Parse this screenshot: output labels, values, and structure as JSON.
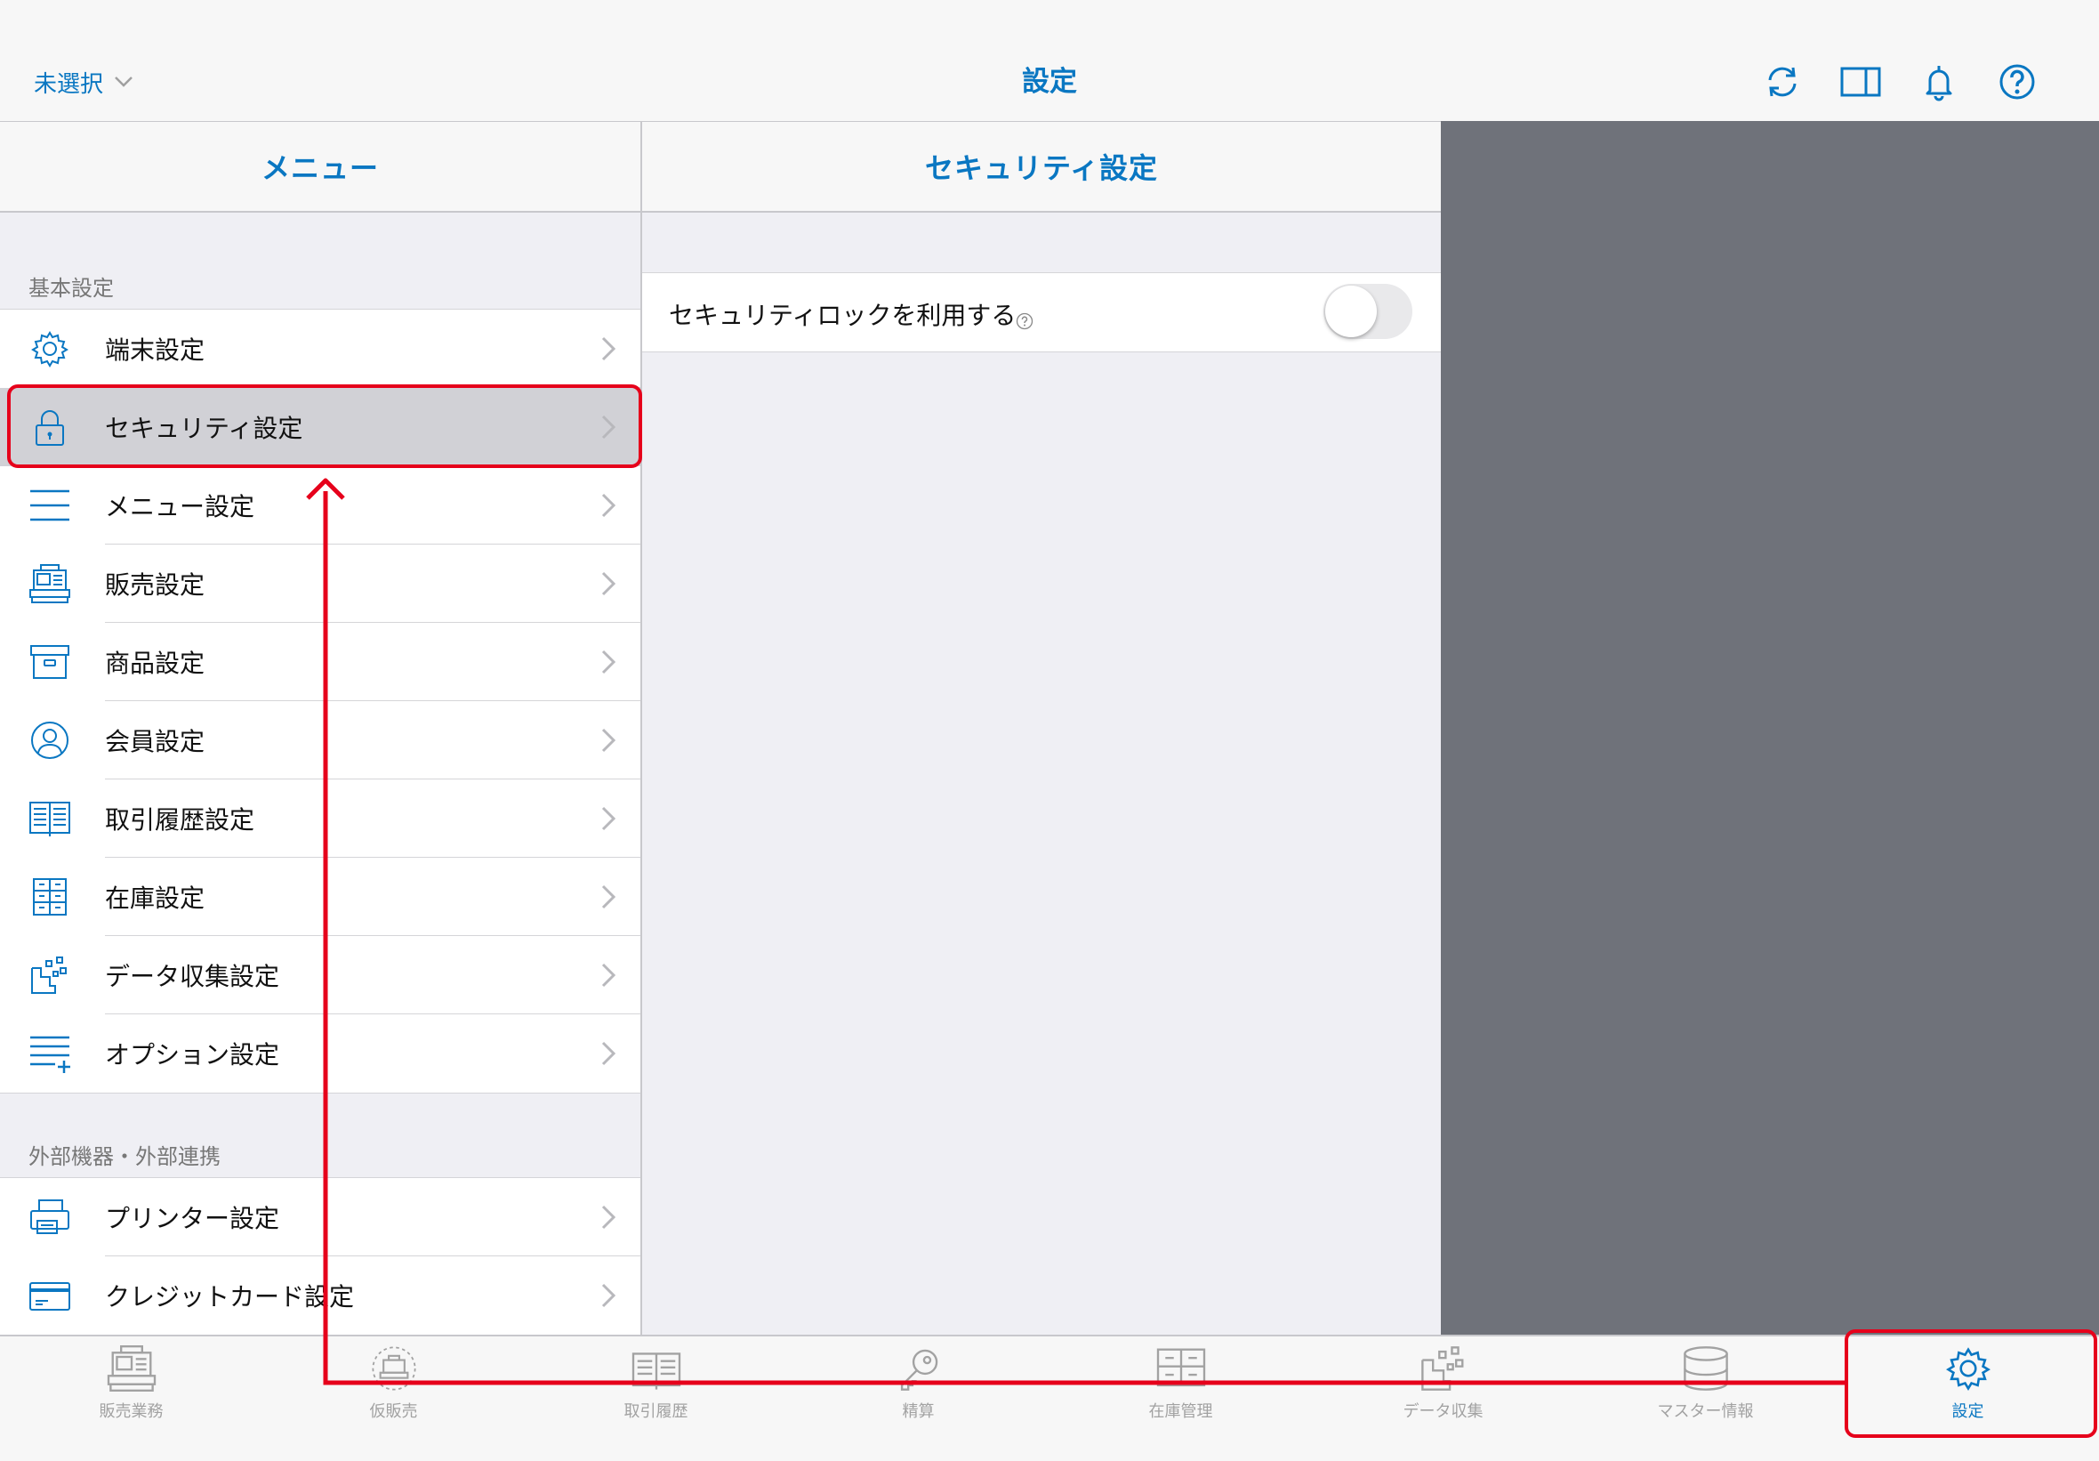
{
  "header": {
    "store_select": "未選択",
    "title": "設定"
  },
  "menu_panel": {
    "title": "メニュー",
    "section_basic": "基本設定",
    "basic_items": [
      {
        "label": "端末設定",
        "icon": "gear-icon"
      },
      {
        "label": "セキュリティ設定",
        "icon": "lock-icon",
        "selected": true
      },
      {
        "label": "メニュー設定",
        "icon": "menu-lines-icon"
      },
      {
        "label": "販売設定",
        "icon": "register-icon"
      },
      {
        "label": "商品設定",
        "icon": "box-icon"
      },
      {
        "label": "会員設定",
        "icon": "user-icon"
      },
      {
        "label": "取引履歴設定",
        "icon": "book-icon"
      },
      {
        "label": "在庫設定",
        "icon": "drawers-icon"
      },
      {
        "label": "データ収集設定",
        "icon": "data-collect-icon"
      },
      {
        "label": "オプション設定",
        "icon": "menu-plus-icon"
      }
    ],
    "section_external": "外部機器・外部連携",
    "external_items": [
      {
        "label": "プリンター設定",
        "icon": "printer-icon"
      },
      {
        "label": "クレジットカード設定",
        "icon": "card-icon"
      }
    ]
  },
  "detail_panel": {
    "title": "セキュリティ設定",
    "security_lock_label": "セキュリティロックを利用する",
    "security_lock_enabled": false
  },
  "tabbar": {
    "tabs": [
      {
        "label": "販売業務",
        "icon": "register-icon"
      },
      {
        "label": "仮販売",
        "icon": "temp-sale-icon"
      },
      {
        "label": "取引履歴",
        "icon": "book-icon"
      },
      {
        "label": "精算",
        "icon": "key-icon"
      },
      {
        "label": "在庫管理",
        "icon": "drawers-icon"
      },
      {
        "label": "データ収集",
        "icon": "data-collect-icon"
      },
      {
        "label": "マスター情報",
        "icon": "database-icon"
      },
      {
        "label": "設定",
        "icon": "gear-icon",
        "active": true
      }
    ]
  },
  "colors": {
    "accent": "#0a77c2",
    "annotation": "#e6001b",
    "empty_pane": "#6f727a"
  }
}
